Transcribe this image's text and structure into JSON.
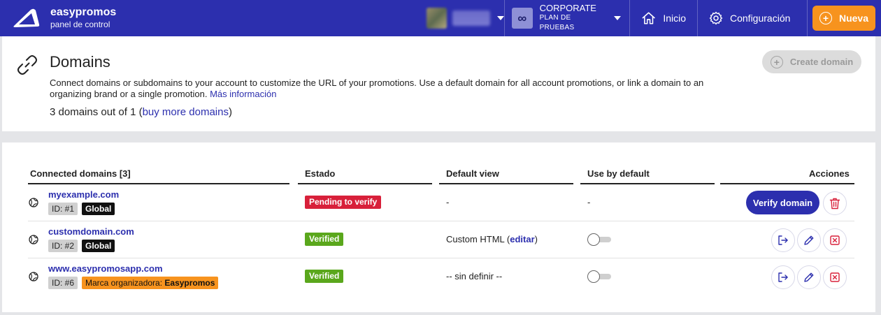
{
  "topbar": {
    "brand_name": "easypromos",
    "brand_sub": "panel de control",
    "plan_icon": "∞",
    "plan_name": "CORPORATE",
    "plan_sub": "PLAN DE PRUEBAS",
    "nav_home": "Inicio",
    "nav_config": "Configuración",
    "new_button": "Nueva",
    "colors": {
      "bar": "#2c2fae",
      "accent": "#f7931e"
    }
  },
  "header": {
    "title": "Domains",
    "description": "Connect domains or subdomains to your account to customize the URL of your promotions. Use a default domain for all account promotions, or link a domain to an organizing brand or a single promotion.",
    "more_info": "Más información",
    "count_prefix": "3 domains out of 1 (",
    "count_link": "buy more domains",
    "count_suffix": ")",
    "create_button": "Create domain"
  },
  "table": {
    "columns": [
      "Connected domains [3]",
      "Estado",
      "Default view",
      "Use by default",
      "Acciones"
    ],
    "rows": [
      {
        "domain": "myexample.com",
        "id_tag": "ID: #1",
        "scope_tag": "Global",
        "status": "Pending to verify",
        "default_view": "-",
        "use_by_default": "-",
        "action": "Verify domain"
      },
      {
        "domain": "customdomain.com",
        "id_tag": "ID: #2",
        "scope_tag": "Global",
        "status": "Verified",
        "default_view_prefix": "Custom HTML (",
        "default_view_link": "editar",
        "default_view_suffix": ")",
        "use_by_default": "off"
      },
      {
        "domain": "www.easypromosapp.com",
        "id_tag": "ID: #6",
        "scope_tag_prefix": "Marca organizadora: ",
        "scope_tag_brand": "Easypromos",
        "status": "Verified",
        "default_view": "-- sin definir --",
        "use_by_default": "off"
      }
    ]
  }
}
